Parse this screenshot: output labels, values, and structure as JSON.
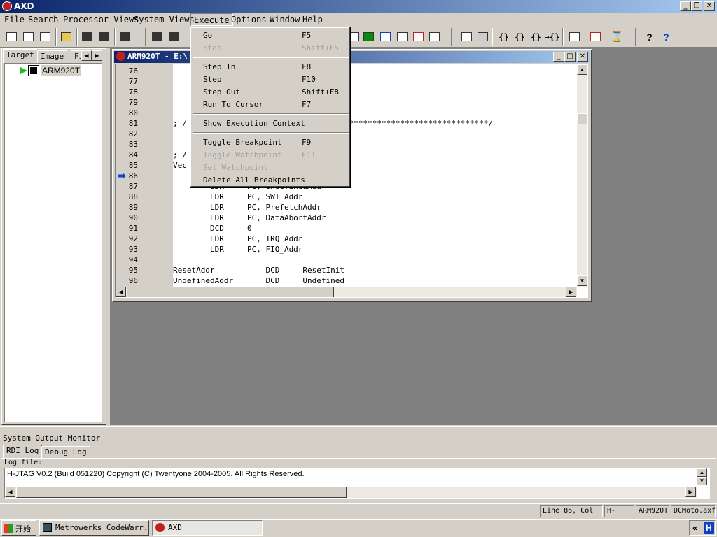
{
  "app": {
    "title": "AXD"
  },
  "menubar": {
    "items": [
      "File",
      "Search",
      "Processor Views",
      "System Views",
      "Execute",
      "Options",
      "Window",
      "Help"
    ]
  },
  "left_panel": {
    "tabs": [
      "Target",
      "Image",
      "Fi"
    ],
    "tree_item": "ARM920T"
  },
  "code_window": {
    "title": "ARM920T - E:\\",
    "current_line": 86,
    "lines": [
      {
        "n": "76",
        "t": ""
      },
      {
        "n": "77",
        "t": ""
      },
      {
        "n": "78",
        "t": "                             heap"
      },
      {
        "n": "79",
        "t": ""
      },
      {
        "n": "80",
        "t": ""
      },
      {
        "n": "81",
        "t": "; /                        *****************************************/"
      },
      {
        "n": "82",
        "t": ""
      },
      {
        "n": "83",
        "t": "                             Y"
      },
      {
        "n": "84",
        "t": "; /"
      },
      {
        "n": "85",
        "t": "Vec"
      },
      {
        "n": "86",
        "t": ""
      },
      {
        "n": "87",
        "t": "        LDR     PC, UndefinedAddr"
      },
      {
        "n": "88",
        "t": "        LDR     PC, SWI_Addr"
      },
      {
        "n": "89",
        "t": "        LDR     PC, PrefetchAddr"
      },
      {
        "n": "90",
        "t": "        LDR     PC, DataAbortAddr"
      },
      {
        "n": "91",
        "t": "        DCD     0"
      },
      {
        "n": "92",
        "t": "        LDR     PC, IRQ_Addr"
      },
      {
        "n": "93",
        "t": "        LDR     PC, FIQ_Addr"
      },
      {
        "n": "94",
        "t": ""
      },
      {
        "n": "95",
        "t": "ResetAddr           DCD     ResetInit"
      },
      {
        "n": "96",
        "t": "UndefinedAddr       DCD     Undefined"
      }
    ]
  },
  "execute_menu": {
    "items": [
      {
        "label": "Go",
        "shortcut": "F5",
        "enabled": true
      },
      {
        "label": "Stop",
        "shortcut": "Shift+F5",
        "enabled": false
      },
      {
        "sep": true
      },
      {
        "label": "Step In",
        "shortcut": "F8",
        "enabled": true
      },
      {
        "label": "Step",
        "shortcut": "F10",
        "enabled": true
      },
      {
        "label": "Step Out",
        "shortcut": "Shift+F8",
        "enabled": true
      },
      {
        "label": "Run To Cursor",
        "shortcut": "F7",
        "enabled": true
      },
      {
        "sep": true
      },
      {
        "label": "Show Execution Context",
        "shortcut": "",
        "enabled": true
      },
      {
        "sep": true
      },
      {
        "label": "Toggle Breakpoint",
        "shortcut": "F9",
        "enabled": true
      },
      {
        "label": "Toggle Watchpoint",
        "shortcut": "F11",
        "enabled": false
      },
      {
        "label": "Set Watchpoint",
        "shortcut": "",
        "enabled": false
      },
      {
        "label": "Delete All Breakpoints",
        "shortcut": "",
        "enabled": true
      }
    ]
  },
  "output_monitor": {
    "title": "System Output Monitor",
    "tabs": [
      "RDI Log",
      "Debug Log"
    ],
    "log_label": "Log file:",
    "log_text": "H-JTAG V0.2 (Build 051220) Copyright (C) Twentyone 2004-2005. All Rights Reserved."
  },
  "statusbar": {
    "cells": [
      "Line 86, Col 0",
      "H-JTAG",
      "ARM920T",
      "DCMoto.axf"
    ]
  },
  "taskbar": {
    "start": "开始",
    "tasks": [
      "Metrowerks CodeWarr...",
      "AXD"
    ],
    "tray_chevron": "«",
    "tray_icon": "H"
  },
  "colors": {
    "title_active": "#0a246a",
    "workspace": "#808080",
    "arrow": "#0a246a"
  }
}
